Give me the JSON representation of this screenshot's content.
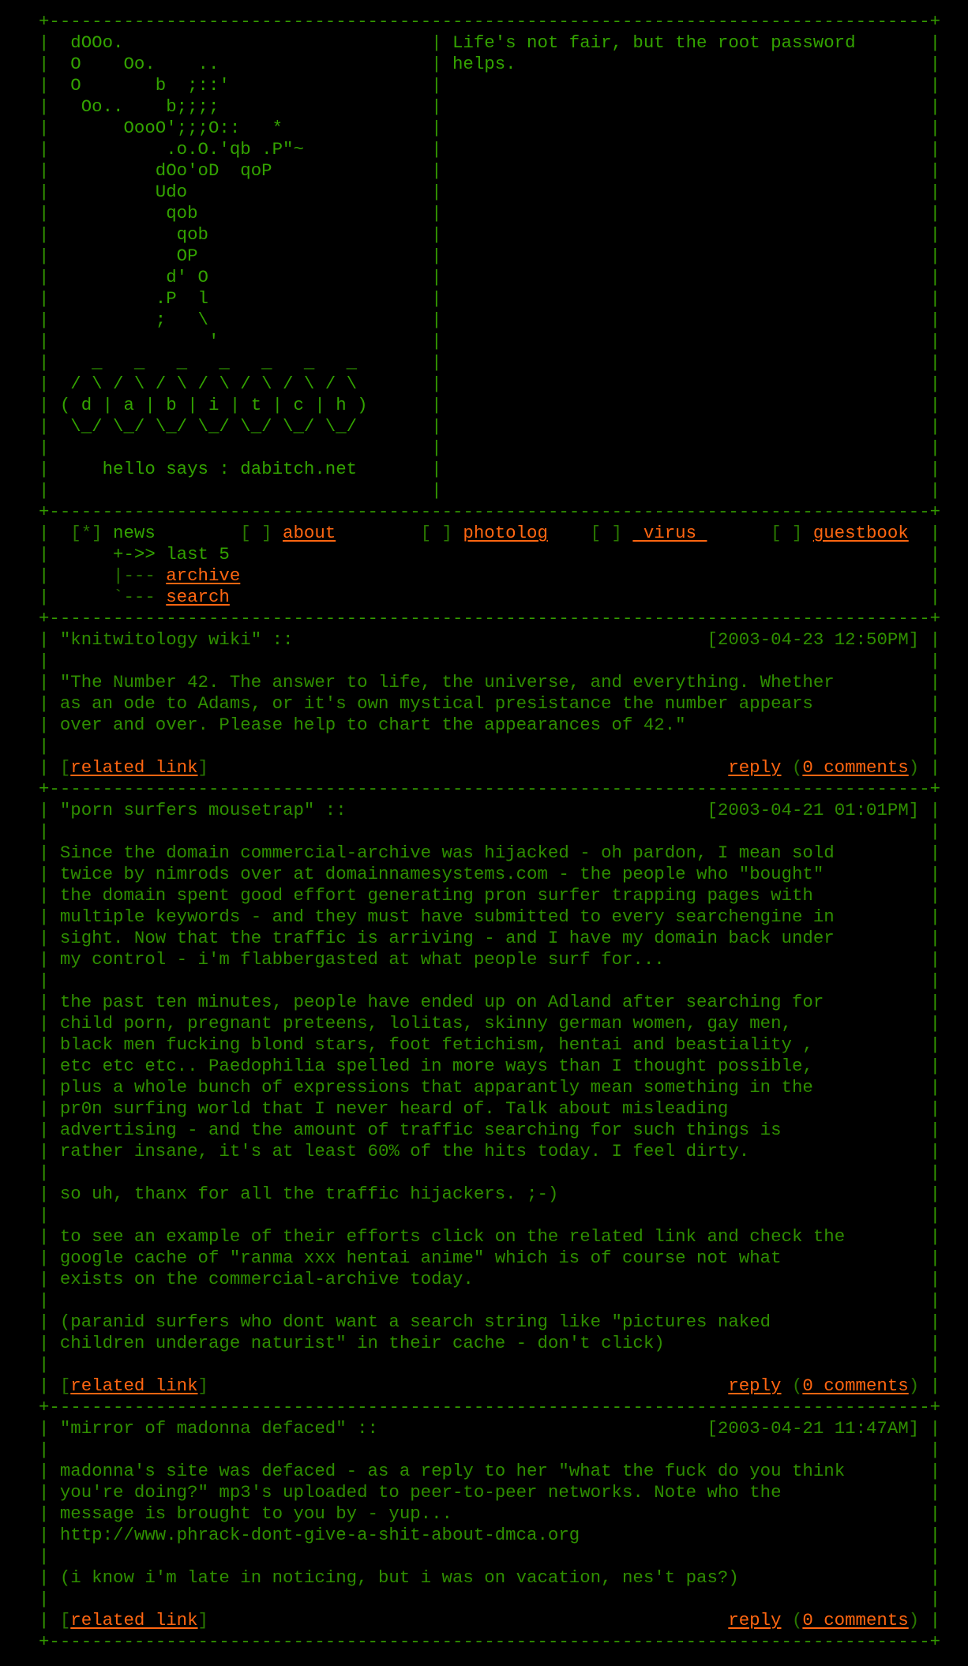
{
  "header": {
    "ascii_art": [
      "  dOOo.",
      "  O    Oo.    ..",
      "  O       b  ;::'",
      "   Oo..    b;;;;",
      "       OooO';;;O::   *",
      "           .o.O.'qb .P\"~",
      "          dOo'oD  qoP",
      "          Udo",
      "           qob",
      "            qob",
      "            OP",
      "           d' O",
      "          .P  l",
      "          ;   \\",
      "               '",
      "    _   _   _   _   _   _   _",
      "  / \\ / \\ / \\ / \\ / \\ / \\ / \\",
      " ( d | a | b | i | t | c | h )",
      "  \\_/ \\_/ \\_/ \\_/ \\_/ \\_/ \\_/",
      "",
      "     hello says : dabitch.net",
      ""
    ],
    "quote": [
      "Life's not fair, but the root password",
      "helps."
    ]
  },
  "nav": {
    "items": [
      {
        "marker": "[*]",
        "label": "news",
        "active": true
      },
      {
        "marker": "[ ]",
        "label": "about",
        "active": false
      },
      {
        "marker": "[ ]",
        "label": "photolog",
        "active": false
      },
      {
        "marker": "[ ]",
        "label": " virus ",
        "active": false
      },
      {
        "marker": "[ ]",
        "label": "guestbook",
        "active": false
      }
    ],
    "submenu": [
      {
        "prefix": "+->> ",
        "label": "last 5",
        "link": false
      },
      {
        "prefix": "|--- ",
        "label": "archive",
        "link": true
      },
      {
        "prefix": "`--- ",
        "label": "search",
        "link": true
      }
    ]
  },
  "posts": [
    {
      "title": "\"knitwitology wiki\" ::",
      "date": "[2003-04-23 12:50PM]",
      "paragraphs": [
        [
          "\"The Number 42. The answer to life, the universe, and everything. Whether",
          "as an ode to Adams, or it's own mystical presistance the number appears",
          "over and over. Please help to chart the appearances of 42.\""
        ]
      ],
      "related_label": "related link",
      "reply_label": "reply",
      "comments_label": "0 comments"
    },
    {
      "title": "\"porn surfers mousetrap\" ::",
      "date": "[2003-04-21 01:01PM]",
      "paragraphs": [
        [
          "Since the domain commercial-archive was hijacked - oh pardon, I mean sold",
          "twice by nimrods over at domainnamesystems.com - the people who \"bought\"",
          "the domain spent good effort generating pron surfer trapping pages with",
          "multiple keywords - and they must have submitted to every searchengine in",
          "sight. Now that the traffic is arriving - and I have my domain back under",
          "my control - i'm flabbergasted at what people surf for..."
        ],
        [
          "the past ten minutes, people have ended up on Adland after searching for",
          "child porn, pregnant preteens, lolitas, skinny german women, gay men,",
          "black men fucking blond stars, foot fetichism, hentai and beastiality ,",
          "etc etc etc.. Paedophilia spelled in more ways than I thought possible,",
          "plus a whole bunch of expressions that apparantly mean something in the",
          "pr0n surfing world that I never heard of. Talk about misleading",
          "advertising - and the amount of traffic searching for such things is",
          "rather insane, it's at least 60% of the hits today. I feel dirty."
        ],
        [
          "so uh, thanx for all the traffic hijackers. ;-)"
        ],
        [
          "to see an example of their efforts click on the related link and check the",
          "google cache of \"ranma xxx hentai anime\" which is of course not what",
          "exists on the commercial-archive today."
        ],
        [
          "(paranid surfers who dont want a search string like \"pictures naked",
          "children underage naturist\" in their cache - don't click)"
        ]
      ],
      "related_label": "related link",
      "reply_label": "reply",
      "comments_label": "0 comments"
    },
    {
      "title": "\"mirror of madonna defaced\" ::",
      "date": "[2003-04-21 11:47AM]",
      "paragraphs": [
        [
          "madonna's site was defaced - as a reply to her \"what the fuck do you think",
          "you're doing?\" mp3's uploaded to peer-to-peer networks. Note who the",
          "message is brought to you by - yup...",
          "http://www.phrack-dont-give-a-shit-about-dmca.org"
        ],
        [
          "(i know i'm late in noticing, but i was on vacation, nes't pas?)"
        ]
      ],
      "related_label": "related link",
      "reply_label": "reply",
      "comments_label": "0 comments"
    }
  ],
  "colors": {
    "background": "#000000",
    "text_green": "#339900",
    "link_orange": "#ff6611"
  }
}
